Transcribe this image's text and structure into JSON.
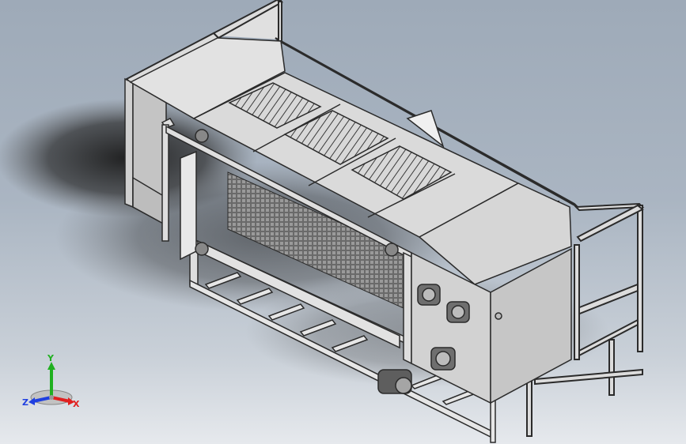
{
  "viewport": {
    "background_top": "#9eaab8",
    "background_bottom": "#e6e9ed",
    "model_line_color": "#2b2b2b",
    "model_fill_color": "#d9d9d9"
  },
  "model": {
    "subject": "freezer-tunnel-unit",
    "visible_parts": [
      "frame",
      "top-panels",
      "grille-panels",
      "evaporator-coil",
      "side-door",
      "control-cabinet",
      "drive-motors",
      "conveyor-belt",
      "base-frame"
    ]
  },
  "triad": {
    "x_label": "X",
    "y_label": "Y",
    "z_label": "Z",
    "x_color": "#e02020",
    "y_color": "#20b020",
    "z_color": "#2040e0"
  }
}
